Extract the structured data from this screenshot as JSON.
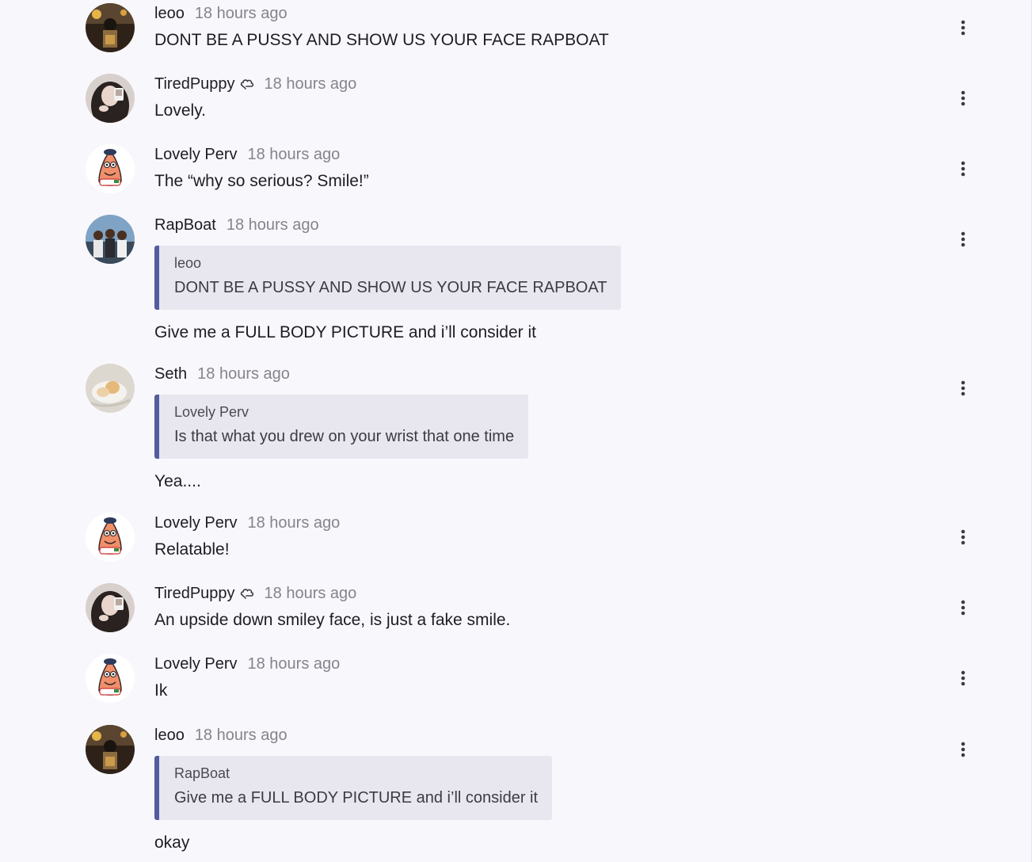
{
  "colors": {
    "background": "#f8f7fc",
    "quote_background": "#e8e7ef",
    "quote_accent": "#525d9e",
    "timestamp": "#85848c",
    "text": "#1d1d22"
  },
  "comments": [
    {
      "author": "leoo",
      "time": "18 hours ago",
      "avatar": "leoo-avatar",
      "text": "DONT BE A PUSSY AND SHOW US YOUR FACE RAPBOAT",
      "menu_icon": "more-vertical-icon"
    },
    {
      "author": "TiredPuppy",
      "badge_icon": "cloud-badge-icon",
      "time": "18 hours ago",
      "avatar": "tiredpuppy-avatar",
      "text": "Lovely.",
      "menu_icon": "more-vertical-icon"
    },
    {
      "author": "Lovely Perv",
      "time": "18 hours ago",
      "avatar": "lovely-perv-avatar",
      "text": "The “why so serious? Smile!”",
      "menu_icon": "more-vertical-icon"
    },
    {
      "author": "RapBoat",
      "time": "18 hours ago",
      "avatar": "rapboat-avatar",
      "quote": {
        "author": "leoo",
        "text": "DONT BE A PUSSY AND SHOW US YOUR FACE RAPBOAT"
      },
      "text": "Give me a FULL BODY PICTURE and i’ll consider it",
      "menu_icon": "more-vertical-icon"
    },
    {
      "author": "Seth",
      "time": "18 hours ago",
      "avatar": "seth-avatar",
      "quote": {
        "author": "Lovely Perv",
        "text": "Is that what you drew on your wrist that one time"
      },
      "text": "Yea....",
      "menu_icon": "more-vertical-icon"
    },
    {
      "author": "Lovely Perv",
      "time": "18 hours ago",
      "avatar": "lovely-perv-avatar",
      "text": "Relatable!",
      "menu_icon": "more-vertical-icon"
    },
    {
      "author": "TiredPuppy",
      "badge_icon": "cloud-badge-icon",
      "time": "18 hours ago",
      "avatar": "tiredpuppy-avatar",
      "text": "An upside down smiley face, is just a fake smile.",
      "menu_icon": "more-vertical-icon"
    },
    {
      "author": "Lovely Perv",
      "time": "18 hours ago",
      "avatar": "lovely-perv-avatar",
      "text": "Ik",
      "menu_icon": "more-vertical-icon"
    },
    {
      "author": "leoo",
      "time": "18 hours ago",
      "avatar": "leoo-avatar",
      "quote": {
        "author": "RapBoat",
        "text": "Give me a FULL BODY PICTURE and i’ll consider it"
      },
      "text": "okay",
      "menu_icon": "more-vertical-icon"
    }
  ]
}
